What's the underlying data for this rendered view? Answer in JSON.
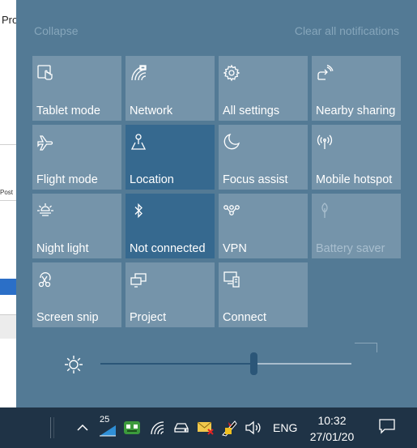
{
  "background_app": {
    "title_fragment": "Pro",
    "small_text": "Post"
  },
  "action_center": {
    "collapse_label": "Collapse",
    "clear_label": "Clear all notifications",
    "tiles": [
      {
        "label": "Tablet mode",
        "icon": "tablet-mode-icon",
        "state": "off"
      },
      {
        "label": "Network",
        "icon": "network-icon",
        "state": "off"
      },
      {
        "label": "All settings",
        "icon": "settings-gear-icon",
        "state": "off"
      },
      {
        "label": "Nearby sharing",
        "icon": "nearby-sharing-icon",
        "state": "off"
      },
      {
        "label": "Flight mode",
        "icon": "airplane-icon",
        "state": "off"
      },
      {
        "label": "Location",
        "icon": "location-icon",
        "state": "on"
      },
      {
        "label": "Focus assist",
        "icon": "moon-icon",
        "state": "off"
      },
      {
        "label": "Mobile hotspot",
        "icon": "hotspot-icon",
        "state": "off"
      },
      {
        "label": "Night light",
        "icon": "night-light-icon",
        "state": "off"
      },
      {
        "label": "Not connected",
        "icon": "bluetooth-icon",
        "state": "on"
      },
      {
        "label": "VPN",
        "icon": "vpn-icon",
        "state": "off"
      },
      {
        "label": "Battery saver",
        "icon": "battery-saver-icon",
        "state": "disabled"
      },
      {
        "label": "Screen snip",
        "icon": "screen-snip-icon",
        "state": "off"
      },
      {
        "label": "Project",
        "icon": "project-icon",
        "state": "off"
      },
      {
        "label": "Connect",
        "icon": "connect-icon",
        "state": "off"
      }
    ],
    "brightness": {
      "icon": "brightness-sun-icon",
      "level": 0.61
    }
  },
  "taskbar": {
    "tray": [
      {
        "icon": "chevron-up-icon"
      },
      {
        "icon": "badge-app-icon",
        "badge": "25"
      },
      {
        "icon": "green-app-icon"
      },
      {
        "icon": "wifi-icon"
      },
      {
        "icon": "drive-icon"
      },
      {
        "icon": "mail-icon"
      },
      {
        "icon": "security-icon"
      },
      {
        "icon": "volume-icon"
      }
    ],
    "language": "ENG",
    "time": "10:32",
    "date": "27/01/20",
    "notification_icon": "action-center-icon"
  },
  "colors": {
    "panel": "#537a95",
    "tile": "#7594aa",
    "tile_active": "#36698f",
    "taskbar": "#1f3346"
  }
}
